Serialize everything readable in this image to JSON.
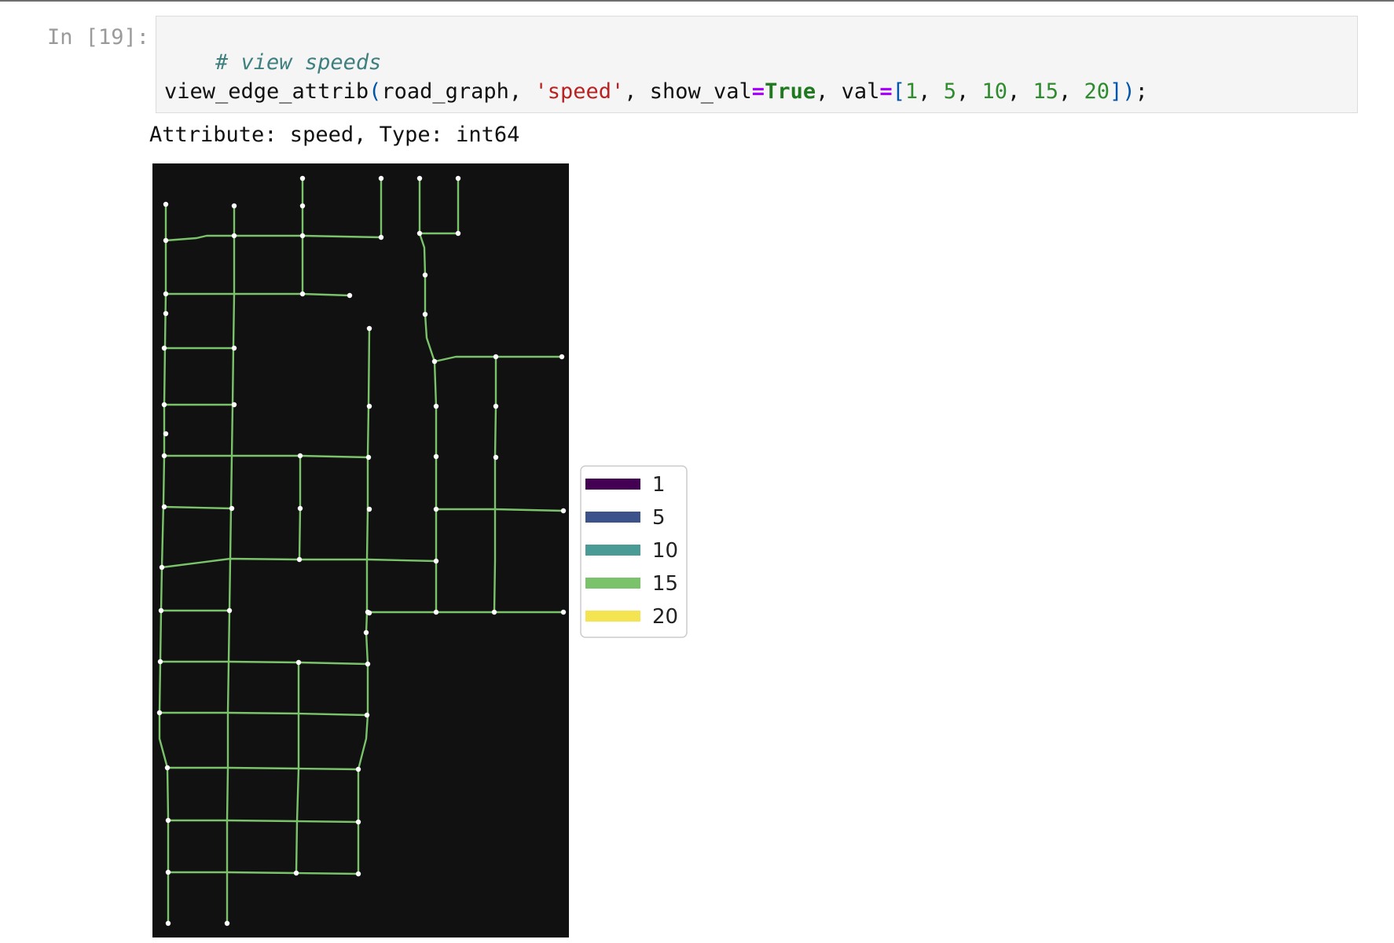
{
  "prompt": "In [19]:",
  "code": {
    "comment": "# view speeds",
    "func": "view_edge_attrib",
    "paren_open": "(",
    "arg1": "road_graph, ",
    "arg2": "'speed'",
    "comma1": ", ",
    "kw1": "show_val",
    "eq1": "=",
    "true_val": "True",
    "comma2": ", ",
    "kw2": "val",
    "eq2": "=",
    "bracket_open": "[",
    "n1": "1",
    "n2": "5",
    "n3": "10",
    "n4": "15",
    "n5": "20",
    "sep": ", ",
    "bracket_close": "]",
    "paren_close": ")",
    "semicolon": ";"
  },
  "output_text": "Attribute: speed, Type: int64",
  "plot": {
    "background": "#111111",
    "edge_color": "#7ac36a",
    "node_color": "#ffffff"
  },
  "chart_data": {
    "type": "network",
    "legend": {
      "placement": "right",
      "entries": [
        {
          "label": "1",
          "color": "#440154"
        },
        {
          "label": "5",
          "color": "#3b528b"
        },
        {
          "label": "10",
          "color": "#4a9a95"
        },
        {
          "label": "15",
          "color": "#7ac36a"
        },
        {
          "label": "20",
          "color": "#f5e451"
        }
      ]
    }
  }
}
